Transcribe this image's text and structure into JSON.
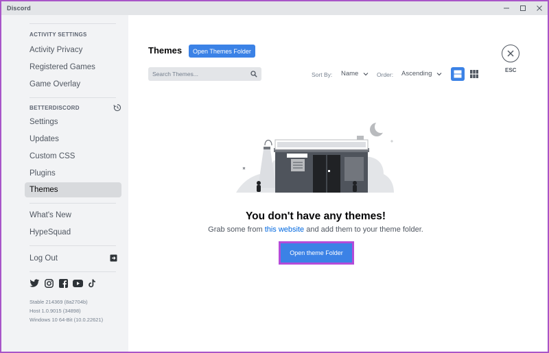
{
  "window": {
    "title": "Discord",
    "controls": {
      "minimize": "–",
      "maximize": "☐",
      "close": "✕"
    }
  },
  "sidebar": {
    "activity_header": "ACTIVITY SETTINGS",
    "activity_items": [
      "Activity Privacy",
      "Registered Games",
      "Game Overlay"
    ],
    "betterdiscord_header": "BETTERDISCORD",
    "betterdiscord_items": [
      "Settings",
      "Updates",
      "Custom CSS",
      "Plugins",
      "Themes"
    ],
    "active_item": "Themes",
    "misc_items": [
      "What's New",
      "HypeSquad"
    ],
    "logout": "Log Out",
    "socials": [
      "twitter-icon",
      "instagram-icon",
      "facebook-icon",
      "youtube-icon",
      "tiktok-icon"
    ],
    "version_lines": [
      "Stable 214369 (8a2704b)",
      "Host 1.0.9015 (34898)",
      "Windows 10 64-Bit (10.0.22621)"
    ]
  },
  "main": {
    "title": "Themes",
    "open_folder_button": "Open Themes Folder",
    "search": {
      "placeholder": "Search Themes...",
      "value": ""
    },
    "sort_by_label": "Sort By:",
    "sort_by_value": "Name",
    "order_label": "Order:",
    "order_value": "Ascending",
    "view_modes": [
      "list-view-icon",
      "grid-view-icon"
    ],
    "active_view": "list-view-icon",
    "esc_label": "ESC",
    "empty_title": "You don't have any themes!",
    "empty_sub_before": "Grab some from ",
    "empty_sub_link": "this website",
    "empty_sub_after": " and add them to your theme folder.",
    "primary_button": "Open theme Folder"
  },
  "colors": {
    "accent": "#3b82e6",
    "highlight_border": "#b44bd9",
    "sidebar_bg": "#f2f3f5",
    "active_item_bg": "#d8dadd"
  }
}
